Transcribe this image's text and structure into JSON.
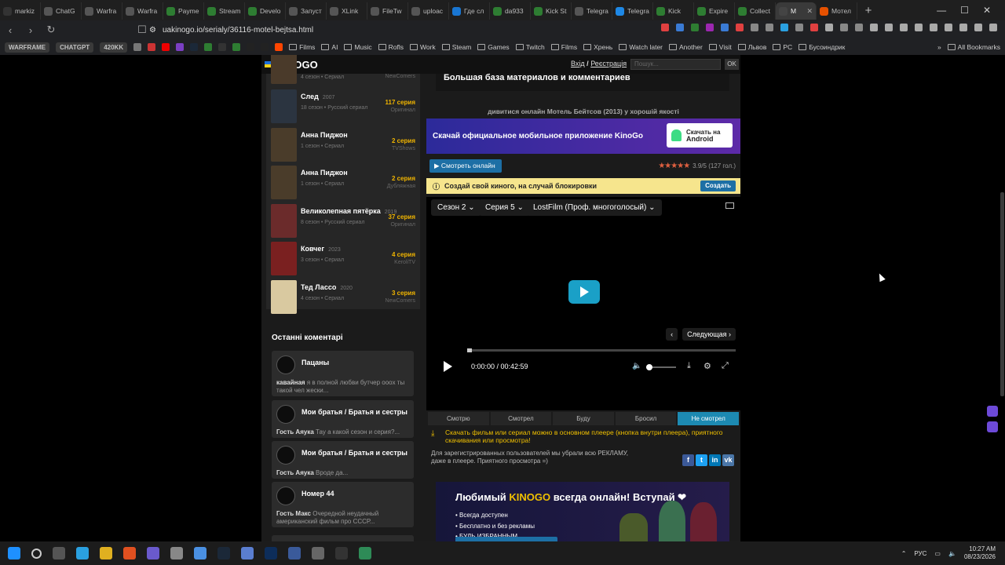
{
  "browser": {
    "tabs": [
      {
        "label": "markiz",
        "color": "#333"
      },
      {
        "label": "ChatG",
        "color": "#555"
      },
      {
        "label": "Warfra",
        "color": "#555"
      },
      {
        "label": "Warfra",
        "color": "#555"
      },
      {
        "label": "Payme",
        "color": "#2e7d32"
      },
      {
        "label": "Stream",
        "color": "#2e7d32"
      },
      {
        "label": "Develo",
        "color": "#2e7d32"
      },
      {
        "label": "Запуст",
        "color": "#555"
      },
      {
        "label": "XLink",
        "color": "#555"
      },
      {
        "label": "FileTw",
        "color": "#555"
      },
      {
        "label": "uploac",
        "color": "#555"
      },
      {
        "label": "Где сл",
        "color": "#1976d2"
      },
      {
        "label": "da933",
        "color": "#2e7d32"
      },
      {
        "label": "Kick St",
        "color": "#2e7d32"
      },
      {
        "label": "Telegra",
        "color": "#555"
      },
      {
        "label": "Telegra",
        "color": "#1e88e5"
      },
      {
        "label": "Kick",
        "color": "#2e7d32"
      },
      {
        "label": "Expire",
        "color": "#2e7d32"
      },
      {
        "label": "Collect",
        "color": "#2e7d32"
      },
      {
        "label": "M",
        "color": "#444",
        "active": true
      },
      {
        "label": "Мотел",
        "color": "#e65100"
      }
    ],
    "new_tab": "+",
    "url": "uakinogo.io/serialy/36116-motel-bejtsa.html",
    "bookmarks": {
      "pills": [
        "WARFRAME",
        "CHATGPT",
        "420KK"
      ],
      "folders": [
        "Films",
        "AI",
        "Music",
        "Rofls",
        "Work",
        "Steam",
        "Games",
        "Twitch",
        "Films",
        "Хрень",
        "Watch later",
        "Another",
        "Visit",
        "Львов",
        "PC",
        "Бусоиндрик"
      ],
      "more": "»",
      "all": "All Bookmarks"
    }
  },
  "site": {
    "logo": "KINOGO",
    "login": "Вхід",
    "separator": "/",
    "register": "Реєстрація",
    "search_placeholder": "Пошук...",
    "search_ok": "OK",
    "top_list_tail": {
      "meta": "4 сезон • Сериал",
      "src": "NewComers"
    },
    "list": [
      {
        "title": "След",
        "year": "2007",
        "meta": "18 сезон • Русский сериал",
        "eps": "117 серия",
        "src": "Оригинал",
        "color": "#2b3440"
      },
      {
        "title": "Анна Пиджон",
        "year": "",
        "meta": "1 сезон • Сериал",
        "eps": "2 серия",
        "src": "TVShows",
        "color": "#4a3c2a"
      },
      {
        "title": "Анна Пиджон",
        "year": "",
        "meta": "1 сезон • Сериал",
        "eps": "2 серия",
        "src": "Дубляжная",
        "color": "#4a3c2a"
      },
      {
        "title": "Великолепная пятёрка",
        "year": "2019",
        "meta": "8 сезон • Русский сериал",
        "eps": "37 серия",
        "src": "Оригинал",
        "color": "#6b2b2b"
      },
      {
        "title": "Ковчег",
        "year": "2023",
        "meta": "3 сезон • Сериал",
        "eps": "4 серия",
        "src": "KeroliTV",
        "color": "#7a2020"
      },
      {
        "title": "Тед Лассо",
        "year": "2020",
        "meta": "4 сезон • Сериал",
        "eps": "3 серия",
        "src": "NewComers",
        "color": "#d9c9a0"
      }
    ],
    "comments_title": "Останні коментарі",
    "comments": [
      {
        "title": "Пацаны",
        "user": "кавайная",
        "text": "я в полной любви бутчер оооx ты такой чел жески..."
      },
      {
        "title": "Мои братья / Братья и сестры",
        "user": "Гость Аяука",
        "text": "Тау а какой сезон и серия?..."
      },
      {
        "title": "Мои братья / Братья и сестры",
        "user": "Гость Аяука",
        "text": "Вроде да..."
      },
      {
        "title": "Номер 44",
        "user": "Гость Макс",
        "text": "Очередной неудачный американский фильм про СССР..."
      }
    ],
    "banner_top": "Большая база материалов и комментариев",
    "watch_line": "дивитися онлайн Мотель Бейтсов (2013) у хорошій якості",
    "app_banner": "Скачай официальное мобильное приложение KinoGo",
    "android_small": "Скачать на",
    "android_big": "Android",
    "watch_online": "Смотреть онлайн",
    "rating_text": "3.9/5 (127 гол.)",
    "stars": "★★★★★",
    "warn_text": "Создай свой киного, на случай блокировки",
    "warn_btn": "Создать",
    "player": {
      "season": "Сезон 2",
      "episode": "Серия 5",
      "voice": "LostFilm (Проф. многоголосый)",
      "next_label": "Следующая",
      "time": "0:00:00 / 00:42:59"
    },
    "status_tabs": [
      "Смотрю",
      "Смотрел",
      "Буду",
      "Бросил",
      "Не смотрел"
    ],
    "active_status": "Не смотрел",
    "download_note": "Скачать фильм или сериал можно в основном плеере (кнопка внутри плеера), приятного скачивания или просмотра!",
    "reg_note": "Для зарегистрированных пользователей мы убрали всю РЕКЛАМУ, даже в плеере. Приятного просмотра =)",
    "share": [
      "f",
      "t",
      "in",
      "vk"
    ],
    "promo": {
      "title_a": "Любимый ",
      "title_b": "KINOGO",
      "title_c": " всегда онлайн! Вступай ❤",
      "points": [
        "Всегда доступен",
        "Бесплатно и без рекламы",
        "БУДЬ ИЗБРАННЫМ"
      ]
    }
  },
  "taskbar": {
    "lang": "РУС",
    "time": "10:27 AM",
    "date": "08/23/2026"
  }
}
